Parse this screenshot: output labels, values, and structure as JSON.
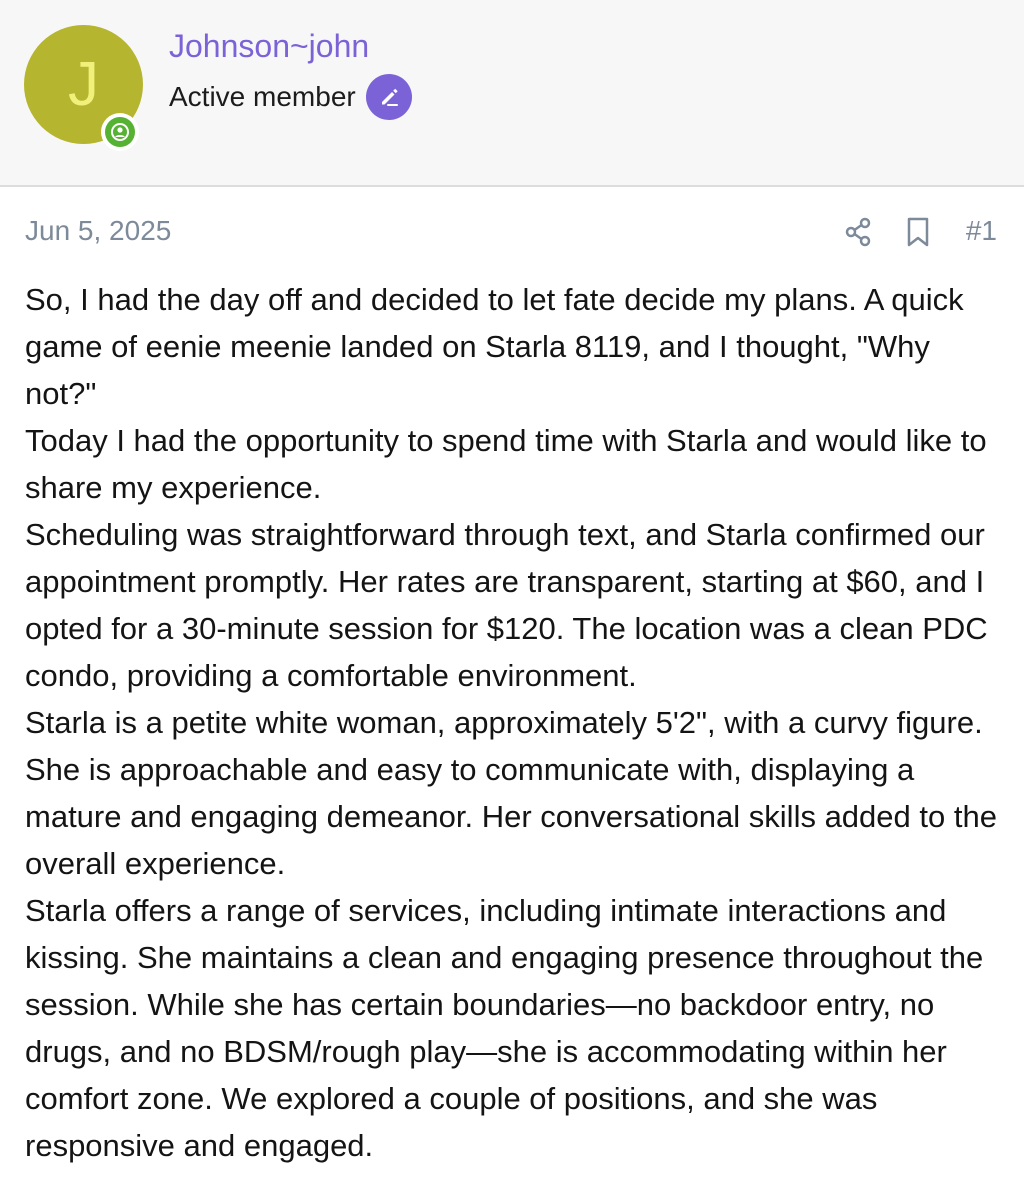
{
  "user": {
    "avatar_letter": "J",
    "name": "Johnson~john",
    "role": "Active member",
    "avatar_color": "#b5b52f",
    "name_color": "#7b62d7",
    "online_status_color": "#56b233"
  },
  "post": {
    "date": "Jun 5, 2025",
    "number": "#1",
    "actions": [
      "share-icon",
      "bookmark-icon"
    ],
    "paragraphs": [
      "So, I had the day off and decided to let fate decide my plans. A quick game of eenie meenie landed on Starla 8119, and I thought, \"Why not?\"",
      "Today I had the opportunity to spend time with Starla and would like to share my experience.",
      "Scheduling was straightforward through text, and Starla confirmed our appointment promptly. Her rates are transparent, starting at $60, and I opted for a 30-minute session for $120. The location was a clean PDC condo, providing a comfortable environment.",
      "Starla is a petite white woman, approximately 5'2\", with a curvy figure. She is approachable and easy to communicate with, displaying a mature and engaging demeanor. Her conversational skills added to the overall experience.",
      "Starla offers a range of services, including intimate interactions and kissing. She maintains a clean and engaging presence throughout the session. While she has certain boundaries—no backdoor entry, no drugs, and no BDSM/rough play—she is accommodating within her comfort zone. We explored a couple of positions, and she was responsive and engaged."
    ]
  }
}
